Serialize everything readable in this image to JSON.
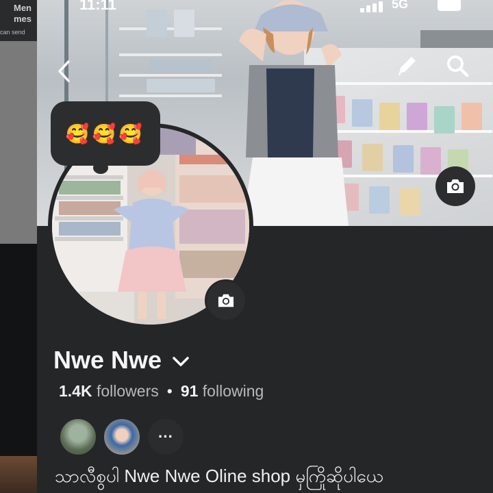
{
  "background": {
    "left_top_title": "Men mes",
    "left_top_sub": "can send"
  },
  "status_bar": {
    "time": "11:11",
    "network": "5G"
  },
  "note": {
    "emojis": "🥰🥰🥰"
  },
  "profile": {
    "name": "Nwe Nwe",
    "followers_count": "1.4K",
    "followers_label": "followers",
    "separator": "•",
    "following_count": "91",
    "following_label": "following",
    "more_friends": "···",
    "bio": "သာလီစွပါ Nwe Nwe Oline shop မှကြိုဆိုပါယေ"
  },
  "icons": {
    "back": "chevron-left-icon",
    "edit": "pencil-icon",
    "search": "search-icon",
    "camera": "camera-icon",
    "name_dropdown": "chevron-down-icon"
  },
  "colors": {
    "page_bg": "#252628",
    "text_primary": "#f5f5f5",
    "text_secondary": "#b8b9bb",
    "button_bg": "#2c2d2f"
  }
}
